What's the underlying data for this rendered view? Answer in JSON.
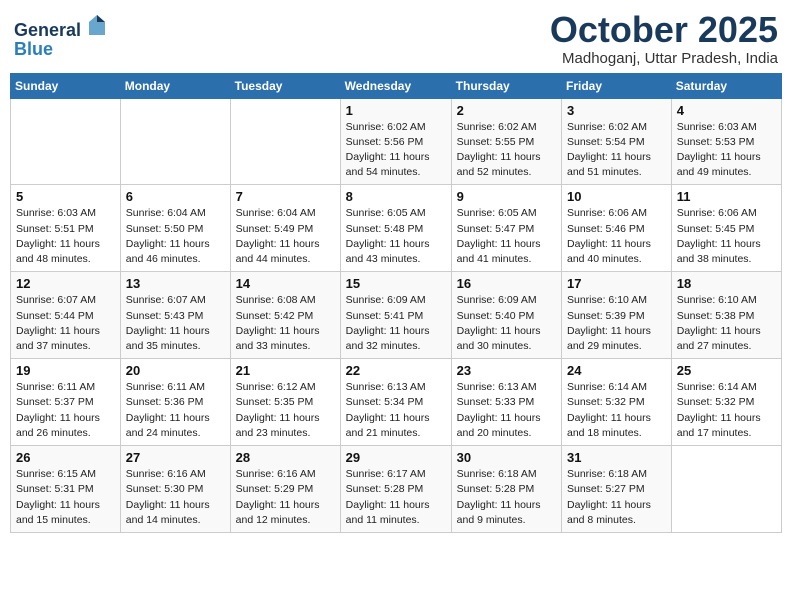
{
  "header": {
    "logo_line1": "General",
    "logo_line2": "Blue",
    "month_title": "October 2025",
    "location": "Madhoganj, Uttar Pradesh, India"
  },
  "weekdays": [
    "Sunday",
    "Monday",
    "Tuesday",
    "Wednesday",
    "Thursday",
    "Friday",
    "Saturday"
  ],
  "weeks": [
    [
      {
        "day": "",
        "info": ""
      },
      {
        "day": "",
        "info": ""
      },
      {
        "day": "",
        "info": ""
      },
      {
        "day": "1",
        "info": "Sunrise: 6:02 AM\nSunset: 5:56 PM\nDaylight: 11 hours\nand 54 minutes."
      },
      {
        "day": "2",
        "info": "Sunrise: 6:02 AM\nSunset: 5:55 PM\nDaylight: 11 hours\nand 52 minutes."
      },
      {
        "day": "3",
        "info": "Sunrise: 6:02 AM\nSunset: 5:54 PM\nDaylight: 11 hours\nand 51 minutes."
      },
      {
        "day": "4",
        "info": "Sunrise: 6:03 AM\nSunset: 5:53 PM\nDaylight: 11 hours\nand 49 minutes."
      }
    ],
    [
      {
        "day": "5",
        "info": "Sunrise: 6:03 AM\nSunset: 5:51 PM\nDaylight: 11 hours\nand 48 minutes."
      },
      {
        "day": "6",
        "info": "Sunrise: 6:04 AM\nSunset: 5:50 PM\nDaylight: 11 hours\nand 46 minutes."
      },
      {
        "day": "7",
        "info": "Sunrise: 6:04 AM\nSunset: 5:49 PM\nDaylight: 11 hours\nand 44 minutes."
      },
      {
        "day": "8",
        "info": "Sunrise: 6:05 AM\nSunset: 5:48 PM\nDaylight: 11 hours\nand 43 minutes."
      },
      {
        "day": "9",
        "info": "Sunrise: 6:05 AM\nSunset: 5:47 PM\nDaylight: 11 hours\nand 41 minutes."
      },
      {
        "day": "10",
        "info": "Sunrise: 6:06 AM\nSunset: 5:46 PM\nDaylight: 11 hours\nand 40 minutes."
      },
      {
        "day": "11",
        "info": "Sunrise: 6:06 AM\nSunset: 5:45 PM\nDaylight: 11 hours\nand 38 minutes."
      }
    ],
    [
      {
        "day": "12",
        "info": "Sunrise: 6:07 AM\nSunset: 5:44 PM\nDaylight: 11 hours\nand 37 minutes."
      },
      {
        "day": "13",
        "info": "Sunrise: 6:07 AM\nSunset: 5:43 PM\nDaylight: 11 hours\nand 35 minutes."
      },
      {
        "day": "14",
        "info": "Sunrise: 6:08 AM\nSunset: 5:42 PM\nDaylight: 11 hours\nand 33 minutes."
      },
      {
        "day": "15",
        "info": "Sunrise: 6:09 AM\nSunset: 5:41 PM\nDaylight: 11 hours\nand 32 minutes."
      },
      {
        "day": "16",
        "info": "Sunrise: 6:09 AM\nSunset: 5:40 PM\nDaylight: 11 hours\nand 30 minutes."
      },
      {
        "day": "17",
        "info": "Sunrise: 6:10 AM\nSunset: 5:39 PM\nDaylight: 11 hours\nand 29 minutes."
      },
      {
        "day": "18",
        "info": "Sunrise: 6:10 AM\nSunset: 5:38 PM\nDaylight: 11 hours\nand 27 minutes."
      }
    ],
    [
      {
        "day": "19",
        "info": "Sunrise: 6:11 AM\nSunset: 5:37 PM\nDaylight: 11 hours\nand 26 minutes."
      },
      {
        "day": "20",
        "info": "Sunrise: 6:11 AM\nSunset: 5:36 PM\nDaylight: 11 hours\nand 24 minutes."
      },
      {
        "day": "21",
        "info": "Sunrise: 6:12 AM\nSunset: 5:35 PM\nDaylight: 11 hours\nand 23 minutes."
      },
      {
        "day": "22",
        "info": "Sunrise: 6:13 AM\nSunset: 5:34 PM\nDaylight: 11 hours\nand 21 minutes."
      },
      {
        "day": "23",
        "info": "Sunrise: 6:13 AM\nSunset: 5:33 PM\nDaylight: 11 hours\nand 20 minutes."
      },
      {
        "day": "24",
        "info": "Sunrise: 6:14 AM\nSunset: 5:32 PM\nDaylight: 11 hours\nand 18 minutes."
      },
      {
        "day": "25",
        "info": "Sunrise: 6:14 AM\nSunset: 5:32 PM\nDaylight: 11 hours\nand 17 minutes."
      }
    ],
    [
      {
        "day": "26",
        "info": "Sunrise: 6:15 AM\nSunset: 5:31 PM\nDaylight: 11 hours\nand 15 minutes."
      },
      {
        "day": "27",
        "info": "Sunrise: 6:16 AM\nSunset: 5:30 PM\nDaylight: 11 hours\nand 14 minutes."
      },
      {
        "day": "28",
        "info": "Sunrise: 6:16 AM\nSunset: 5:29 PM\nDaylight: 11 hours\nand 12 minutes."
      },
      {
        "day": "29",
        "info": "Sunrise: 6:17 AM\nSunset: 5:28 PM\nDaylight: 11 hours\nand 11 minutes."
      },
      {
        "day": "30",
        "info": "Sunrise: 6:18 AM\nSunset: 5:28 PM\nDaylight: 11 hours\nand 9 minutes."
      },
      {
        "day": "31",
        "info": "Sunrise: 6:18 AM\nSunset: 5:27 PM\nDaylight: 11 hours\nand 8 minutes."
      },
      {
        "day": "",
        "info": ""
      }
    ]
  ]
}
